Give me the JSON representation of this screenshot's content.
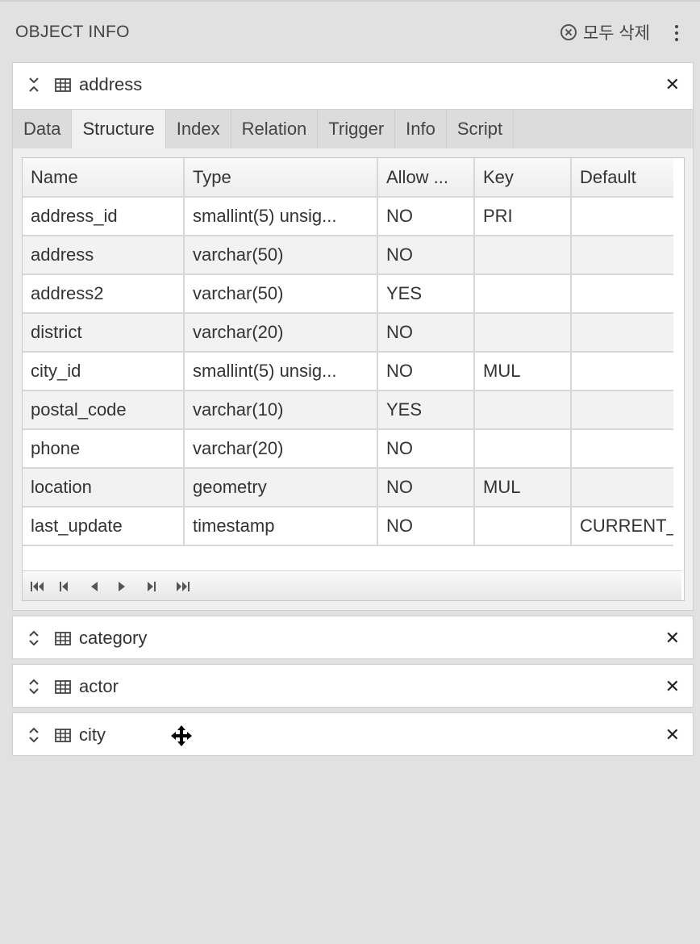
{
  "header": {
    "title": "OBJECT INFO",
    "delete_all_label": "모두 삭제"
  },
  "panels": [
    {
      "name": "address",
      "tabs": [
        {
          "label": "Data"
        },
        {
          "label": "Structure"
        },
        {
          "label": "Index"
        },
        {
          "label": "Relation"
        },
        {
          "label": "Trigger"
        },
        {
          "label": "Info"
        },
        {
          "label": "Script"
        }
      ],
      "active_tab": "Structure",
      "columns": [
        "Name",
        "Type",
        "Allow ...",
        "Key",
        "Default"
      ],
      "rows": [
        [
          "address_id",
          "smallint(5) unsig...",
          "NO",
          "PRI",
          ""
        ],
        [
          "address",
          "varchar(50)",
          "NO",
          "",
          ""
        ],
        [
          "address2",
          "varchar(50)",
          "YES",
          "",
          ""
        ],
        [
          "district",
          "varchar(20)",
          "NO",
          "",
          ""
        ],
        [
          "city_id",
          "smallint(5) unsig...",
          "NO",
          "MUL",
          ""
        ],
        [
          "postal_code",
          "varchar(10)",
          "YES",
          "",
          ""
        ],
        [
          "phone",
          "varchar(20)",
          "NO",
          "",
          ""
        ],
        [
          "location",
          "geometry",
          "NO",
          "MUL",
          ""
        ],
        [
          "last_update",
          "timestamp",
          "NO",
          "",
          "CURRENT_"
        ]
      ]
    },
    {
      "name": "category"
    },
    {
      "name": "actor"
    },
    {
      "name": "city"
    }
  ],
  "icons": {
    "collapse": "chevron-collapse-icon",
    "expand": "chevron-expand-icon",
    "table": "table-icon",
    "close": "close-icon",
    "menu": "kebab-menu-icon",
    "delete_all": "circle-x-icon",
    "cursor": "move-cursor-icon"
  },
  "colors": {
    "background": "#e1e1e1",
    "panel": "#ffffff",
    "tab_bar": "#dcdcdc",
    "row_alt": "#f2f2f2"
  }
}
